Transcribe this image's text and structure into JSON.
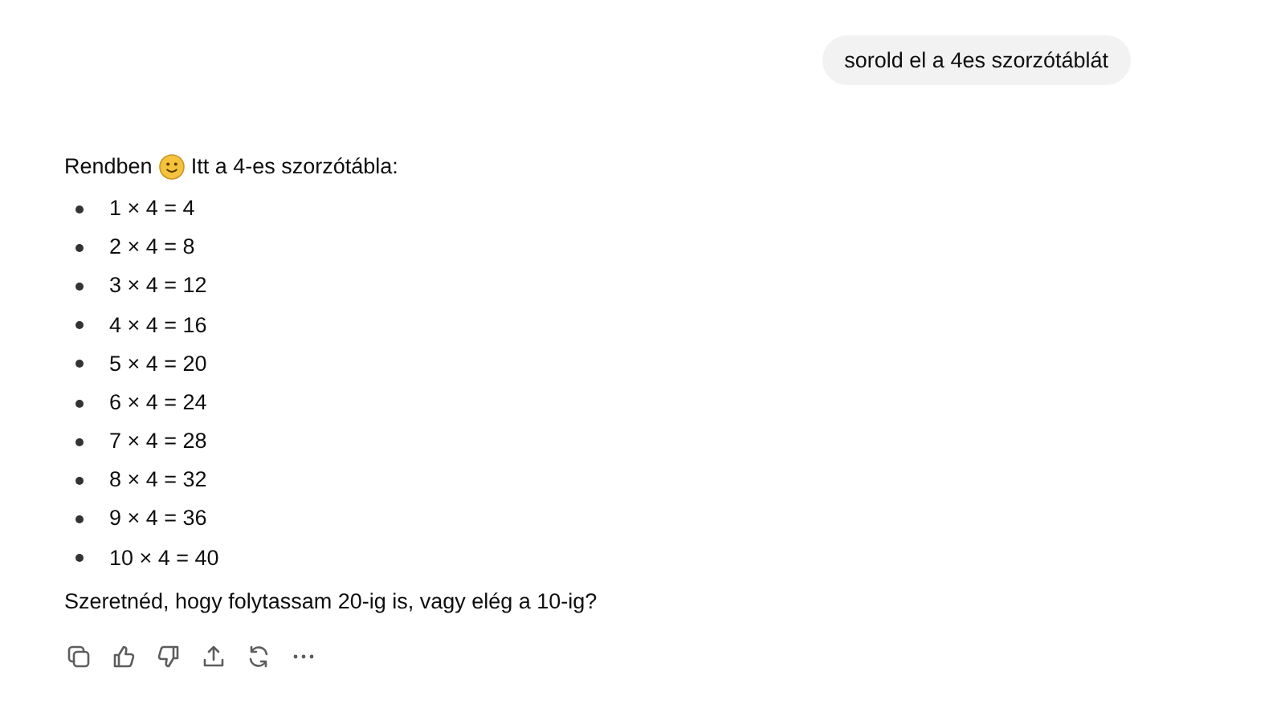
{
  "user_message": "sorold el a 4es szorzótáblát",
  "reply": {
    "intro_before": "Rendben",
    "intro_after": "Itt a 4-es szorzótábla:",
    "items": [
      "1 × 4 = 4",
      "2 × 4 = 8",
      "3 × 4 = 12",
      "4 × 4 = 16",
      "5 × 4 = 20",
      "6 × 4 = 24",
      "7 × 4 = 28",
      "8 × 4 = 32",
      "9 × 4 = 36",
      "10 × 4 = 40"
    ],
    "question": "Szeretnéd, hogy folytassam 20-ig is, vagy elég a 10-ig?"
  },
  "actions": [
    {
      "kind": "copy"
    },
    {
      "kind": "like"
    },
    {
      "kind": "dislike"
    },
    {
      "kind": "share"
    },
    {
      "kind": "regenerate"
    },
    {
      "kind": "more"
    }
  ]
}
